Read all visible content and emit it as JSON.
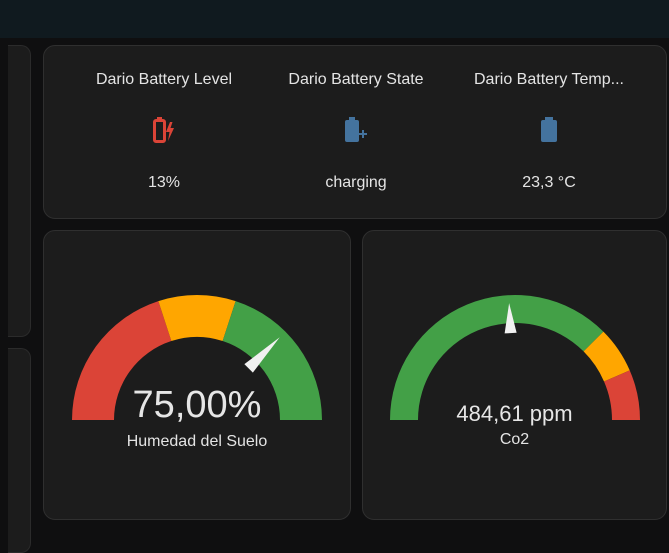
{
  "entities": [
    {
      "name": "Dario Battery Level",
      "state": "13%",
      "icon": "battery-charging-alert-icon",
      "icon_color": "#db4437"
    },
    {
      "name": "Dario Battery State",
      "state": "charging",
      "icon": "battery-plus-icon",
      "icon_color": "#44739e"
    },
    {
      "name": "Dario Battery Temp...",
      "state": "23,3 °C",
      "icon": "battery-icon",
      "icon_color": "#44739e"
    }
  ],
  "gauges": [
    {
      "value_text": "75,00%",
      "label": "Humedad del Suelo",
      "value_fraction": 0.75,
      "segments": [
        {
          "to": 0.4,
          "color": "#db4437"
        },
        {
          "to": 0.6,
          "color": "#ffa600"
        },
        {
          "to": 1.0,
          "color": "#43a047"
        }
      ]
    },
    {
      "value_text": "484,61 ppm",
      "label": "Co2",
      "value_fraction": 0.484,
      "segments": [
        {
          "to": 0.75,
          "color": "#43a047"
        },
        {
          "to": 0.87,
          "color": "#ffa600"
        },
        {
          "to": 1.0,
          "color": "#db4437"
        }
      ]
    }
  ],
  "colors": {
    "card_bg": "#1c1c1c",
    "needle": "#f1f1f1"
  }
}
